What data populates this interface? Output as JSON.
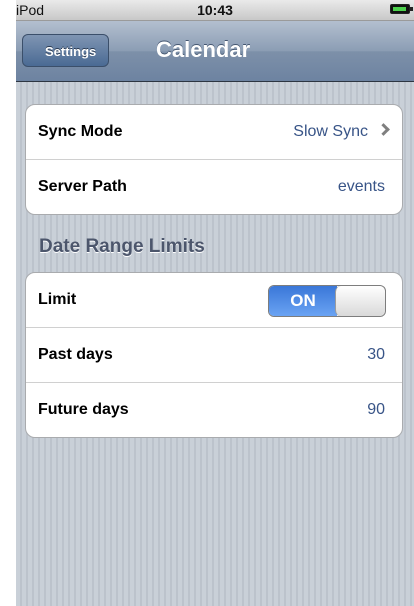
{
  "status_bar": {
    "carrier": "iPod",
    "time": "10:43",
    "battery_icon": "battery-charging-icon",
    "battery_color": "#4cd14c"
  },
  "nav_bar": {
    "back_label": "Settings",
    "title": "Calendar"
  },
  "sync_group": {
    "rows": [
      {
        "label": "Sync Mode",
        "value": "Slow Sync",
        "icon": "chevron-right-icon"
      },
      {
        "label": "Server Path",
        "value": "events"
      }
    ]
  },
  "date_range": {
    "header": "Date Range Limits",
    "limit": {
      "label": "Limit",
      "toggle_text": "ON",
      "enabled": true
    },
    "past_days": {
      "label": "Past days",
      "value": "30"
    },
    "future_days": {
      "label": "Future days",
      "value": "90"
    }
  },
  "colors": {
    "accent": "#385487",
    "toggle_on": "#3a77d8",
    "nav_bar": "#7d90a9",
    "background": "#c5ccd4"
  }
}
